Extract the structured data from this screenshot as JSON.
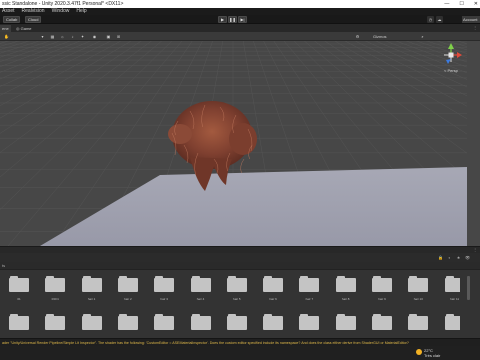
{
  "window": {
    "title": "ssic Standalone - Unity 2020.3.47f1 Personal* <DX11>",
    "controls": [
      "—",
      "☐",
      "✕"
    ]
  },
  "menu": [
    "Asset",
    "Realvision",
    "Window",
    "Help"
  ],
  "toolbar": {
    "collab_label": "Collab",
    "cloud_label": "Cloud",
    "play_icon": "play-icon",
    "pause_icon": "pause-icon",
    "step_icon": "step-icon",
    "account_label": "Account"
  },
  "tabs": [
    {
      "label": "ene",
      "active": true
    },
    {
      "label": "Game",
      "active": false
    }
  ],
  "scene_tools": {
    "mode_label": "2D",
    "gizmos_label": "Gizmos",
    "persp_label": "< Persp"
  },
  "folders_row1": [
    "01",
    "030 ti",
    "hair 1",
    "hair 2",
    "hair 3",
    "hair 4",
    "hair 5",
    "hair 6",
    "hair 7",
    "hair 8",
    "hair 9",
    "hair 10",
    "hair 11",
    "hair 12",
    "hair 13",
    "hair 14"
  ],
  "folders_row2": [
    "",
    "",
    "",
    "",
    "",
    "",
    "",
    "",
    "",
    "",
    "",
    "",
    "",
    "",
    "",
    ""
  ],
  "console": {
    "message": "ader \"Unity/Universal Render Pipeline/Simple Lit Inspector\". The shader has the following: 'CustomEditor = ASEMaterialInspector'. Does the custom editor specified include its namespace? And does the class either derive from ShaderGUI or MaterialEditor?"
  },
  "taskbar": {
    "temp": "22°C",
    "weather": "Très clair"
  },
  "colors": {
    "viewport_bg": "#474747",
    "plane": "#9e9fad",
    "hair": "#8a4a36",
    "warning_text": "#e0b94a"
  }
}
